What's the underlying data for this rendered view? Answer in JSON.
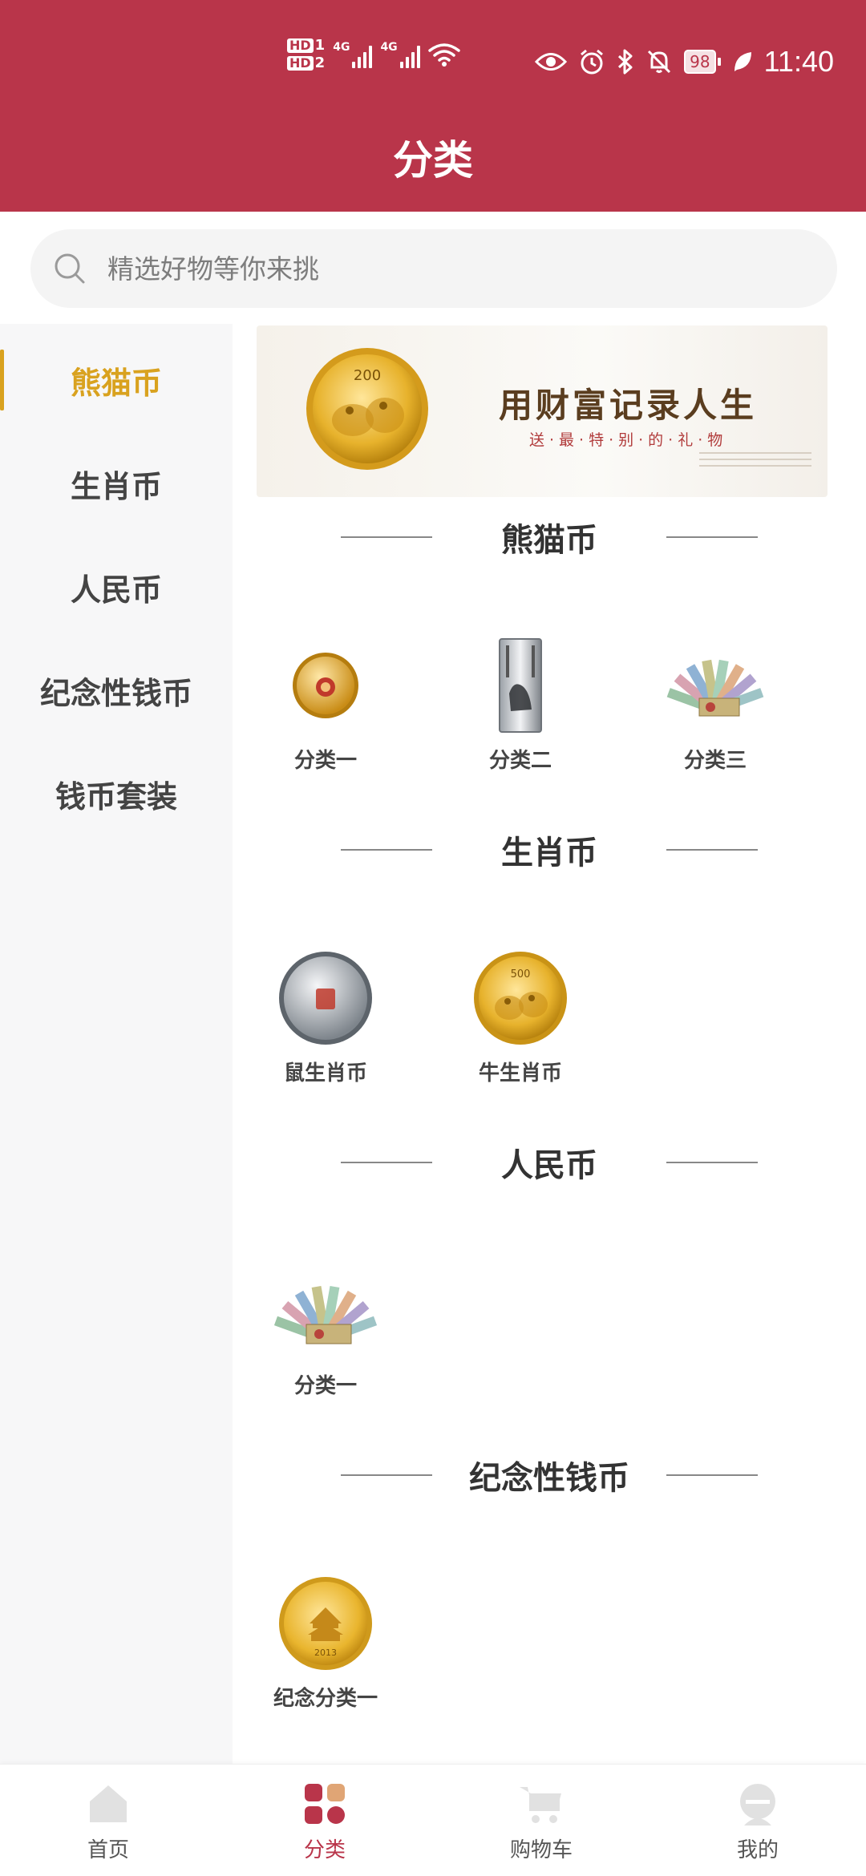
{
  "status_bar": {
    "hd1": "HD",
    "hd1_sub": "1",
    "hd2": "HD",
    "hd2_sub": "2",
    "net1": "4G",
    "net2": "4G",
    "battery": "98",
    "time": "11:40"
  },
  "header": {
    "title": "分类"
  },
  "search": {
    "placeholder": "精选好物等你来挑"
  },
  "sidebar": {
    "items": [
      {
        "label": "熊猫币",
        "active": true
      },
      {
        "label": "生肖币"
      },
      {
        "label": "人民币"
      },
      {
        "label": "纪念性钱币"
      },
      {
        "label": "钱币套装"
      }
    ]
  },
  "banner": {
    "title": "用财富记录人生",
    "subtitle": "送·最·特·别·的·礼·物",
    "coin_value": "200"
  },
  "sections": [
    {
      "title": "熊猫币",
      "items": [
        {
          "label": "分类一",
          "icon": "gold-coin-icon"
        },
        {
          "label": "分类二",
          "icon": "silver-bar-icon"
        },
        {
          "label": "分类三",
          "icon": "banknote-fan-icon"
        }
      ]
    },
    {
      "title": "生肖币",
      "items": [
        {
          "label": "鼠生肖币",
          "icon": "silver-coin-icon"
        },
        {
          "label": "牛生肖币",
          "icon": "panda-gold-coin-icon",
          "coin_value": "500"
        }
      ]
    },
    {
      "title": "人民币",
      "items": [
        {
          "label": "分类一",
          "icon": "banknote-fan-icon"
        }
      ]
    },
    {
      "title": "纪念性钱币",
      "items": [
        {
          "label": "纪念分类一",
          "icon": "temple-gold-coin-icon",
          "coin_year": "2013"
        }
      ]
    }
  ],
  "tabbar": {
    "tabs": [
      {
        "label": "首页",
        "icon": "home-icon"
      },
      {
        "label": "分类",
        "icon": "category-icon",
        "active": true
      },
      {
        "label": "购物车",
        "icon": "cart-icon"
      },
      {
        "label": "我的",
        "icon": "profile-icon"
      }
    ]
  },
  "colors": {
    "brand": "#b9354a",
    "accent": "#d9a21f"
  }
}
